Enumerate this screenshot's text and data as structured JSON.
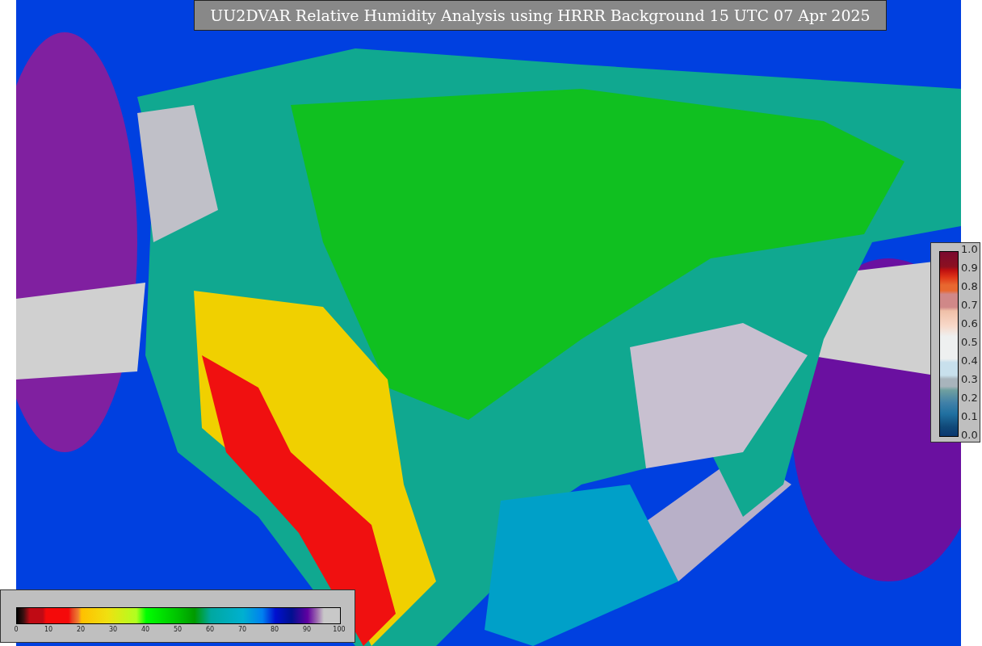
{
  "title": "UU2DVAR Relative Humidity Analysis using HRRR Background 15 UTC 07 Apr 2025",
  "humidity_colorbar": {
    "ticks": [
      "0",
      "10",
      "20",
      "30",
      "40",
      "50",
      "60",
      "70",
      "80",
      "90",
      "100"
    ]
  },
  "ratio_colorbar": {
    "ticks": [
      "1.0",
      "0.9",
      "0.8",
      "0.7",
      "0.6",
      "0.5",
      "0.4",
      "0.3",
      "0.2",
      "0.1",
      "0.0"
    ]
  }
}
